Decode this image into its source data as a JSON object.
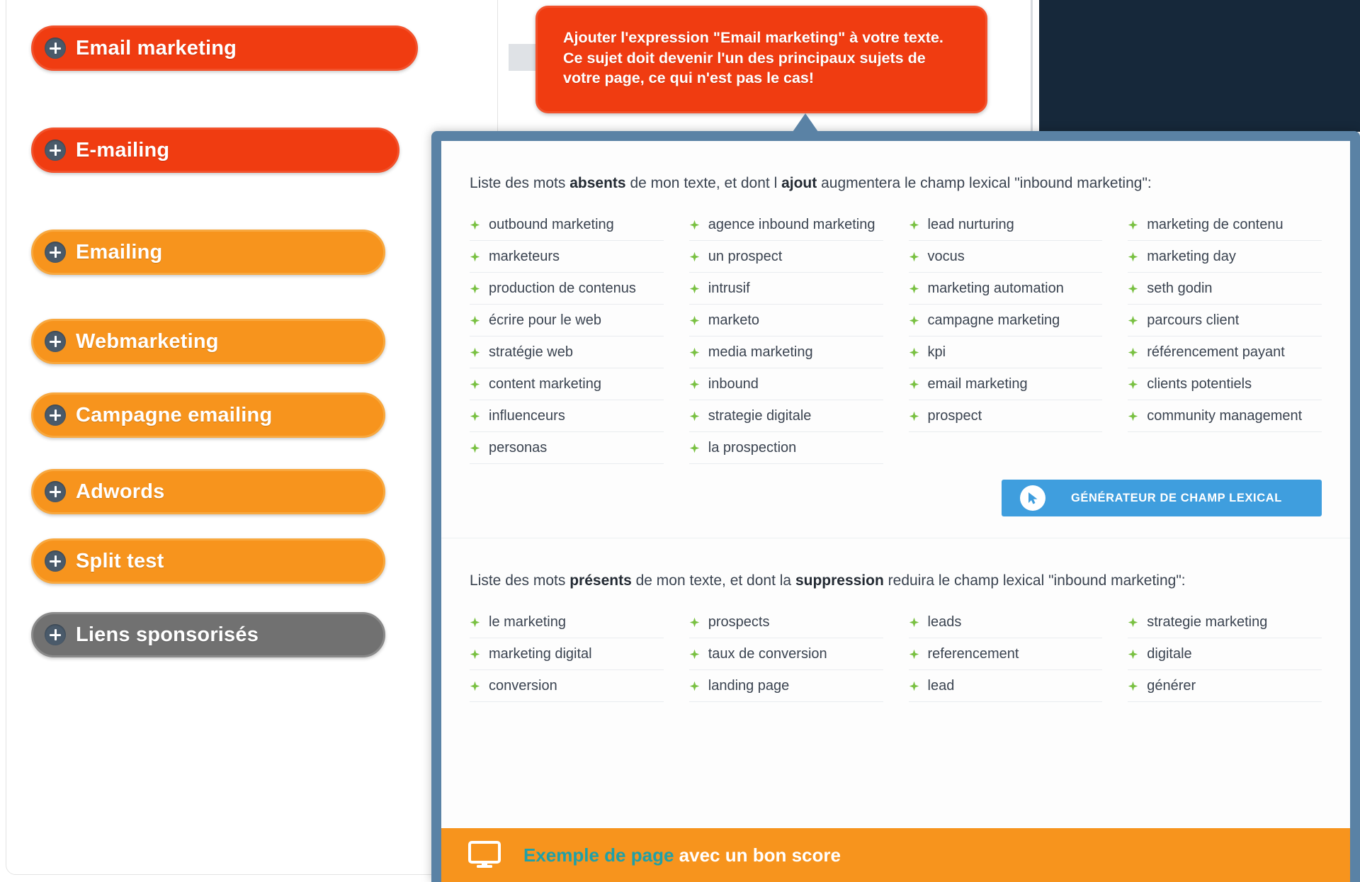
{
  "colors": {
    "red_pill": "#f03c11",
    "orange_pill": "#f7941d",
    "grey_pill": "#717171",
    "panel_border": "#5a82a5",
    "cta_blue": "#3f9ede",
    "footer_orange": "#f7941d",
    "footer_teal": "#1fa0a8",
    "bullet_green": "#7ac143",
    "dark_region": "#16283a"
  },
  "sidebar": {
    "items": [
      {
        "label": "Email marketing",
        "variant": "red",
        "icon": "plus-icon"
      },
      {
        "label": "E-mailing",
        "variant": "red",
        "icon": "plus-icon"
      },
      {
        "label": "Emailing",
        "variant": "orange",
        "icon": "plus-icon"
      },
      {
        "label": "Webmarketing",
        "variant": "orange",
        "icon": "plus-icon"
      },
      {
        "label": "Campagne emailing",
        "variant": "orange",
        "icon": "plus-icon"
      },
      {
        "label": "Adwords",
        "variant": "orange",
        "icon": "plus-icon"
      },
      {
        "label": "Split test",
        "variant": "orange",
        "icon": "plus-icon"
      },
      {
        "label": "Liens sponsorisés",
        "variant": "grey",
        "icon": "plus-icon"
      }
    ]
  },
  "tooltip": {
    "text": "Ajouter l'expression \"Email marketing\" à votre texte.\nCe sujet doit devenir l'un des principaux sujets de votre page, ce qui n'est pas le cas!"
  },
  "panel": {
    "absent_section": {
      "head_prefix": "Liste des mots ",
      "head_bold_1": "absents",
      "head_middle": " de mon texte, et dont l ",
      "head_bold_2": "ajout",
      "head_suffix": " augmentera le champ lexical \"inbound marketing\":",
      "columns": [
        [
          "outbound marketing",
          "marketeurs",
          "production de contenus",
          "écrire pour le web",
          "stratégie web",
          "content marketing",
          "influenceurs",
          "personas"
        ],
        [
          "agence inbound marketing",
          "un prospect",
          "intrusif",
          "marketo",
          "media marketing",
          "inbound",
          "strategie digitale",
          "la prospection"
        ],
        [
          "lead nurturing",
          "vocus",
          "marketing automation",
          "campagne marketing",
          "kpi",
          "email marketing",
          "prospect"
        ],
        [
          "marketing de contenu",
          "marketing day",
          "seth godin",
          "parcours client",
          "référencement payant",
          "clients potentiels",
          "community management"
        ]
      ]
    },
    "cta": {
      "label": "GÉNÉRATEUR DE CHAMP LEXICAL",
      "icon": "cursor-arrow-icon"
    },
    "present_section": {
      "head_prefix": "Liste des mots ",
      "head_bold_1": "présents",
      "head_middle": " de mon texte, et dont la ",
      "head_bold_2": "suppression",
      "head_suffix": " reduira le champ lexical \"inbound marketing\":",
      "columns": [
        [
          "le marketing",
          "marketing digital",
          "conversion"
        ],
        [
          "prospects",
          "taux de conversion",
          "landing page"
        ],
        [
          "leads",
          "referencement",
          "lead"
        ],
        [
          "strategie marketing",
          "digitale",
          "générer"
        ]
      ]
    },
    "footer": {
      "icon": "monitor-icon",
      "link_text": "Exemple de page",
      "rest_text": " avec un bon score"
    }
  }
}
